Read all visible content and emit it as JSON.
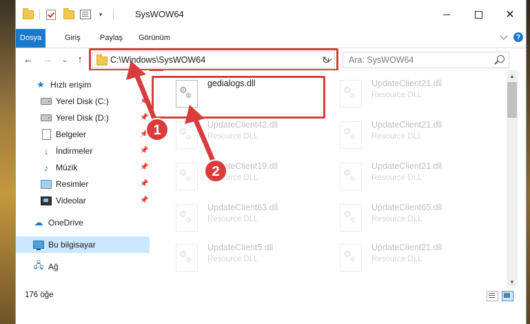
{
  "window": {
    "title": "SysWOW64"
  },
  "window_controls": {
    "minimize": "",
    "maximize": "",
    "close": "✕"
  },
  "ribbon": {
    "tabs": [
      "Dosya",
      "Giriş",
      "Paylaş",
      "Görünüm"
    ],
    "help": "?"
  },
  "navigation": {
    "back": "←",
    "forward": "→",
    "recent": "⌄",
    "up": "↑"
  },
  "address": {
    "path": "C:\\Windows\\SysWOW64",
    "refresh": "↻"
  },
  "search": {
    "placeholder": "Ara: SysWOW64"
  },
  "nav_pane": {
    "items": [
      {
        "label": "Hızlı erişim",
        "icon": "star-icon",
        "pinned": false
      },
      {
        "label": "Yerel Disk (C:)",
        "icon": "drive-icon",
        "pinned": true
      },
      {
        "label": "Yerel Disk (D:)",
        "icon": "drive-icon",
        "pinned": true
      },
      {
        "label": "Belgeler",
        "icon": "document-icon",
        "pinned": true
      },
      {
        "label": "İndirmeler",
        "icon": "download-icon",
        "pinned": true
      },
      {
        "label": "Müzik",
        "icon": "music-icon",
        "pinned": true
      },
      {
        "label": "Resimler",
        "icon": "pictures-icon",
        "pinned": true
      },
      {
        "label": "Videolar",
        "icon": "video-icon",
        "pinned": true
      },
      {
        "label": "OneDrive",
        "icon": "cloud-icon",
        "pinned": false
      },
      {
        "label": "Bu bilgisayar",
        "icon": "computer-icon",
        "pinned": false,
        "selected": true
      },
      {
        "label": "Ağ",
        "icon": "network-icon",
        "pinned": false
      }
    ]
  },
  "files": {
    "highlighted": {
      "name": "gedialogs.dll",
      "type": ""
    },
    "faded": [
      {
        "name": "UpdateClient21.dll",
        "type": "Resource DLL"
      },
      {
        "name": "UpdateClient42.dll",
        "type": "Resource DLL"
      },
      {
        "name": "UpdateClient21.dll",
        "type": "Resource DLL"
      },
      {
        "name": "UpdateClient19.dll",
        "type": "Resource DLL"
      },
      {
        "name": "UpdateClient21.dll",
        "type": "Resource DLL"
      },
      {
        "name": "UpdateClient63.dll",
        "type": "Resource DLL"
      },
      {
        "name": "UpdateClient65.dll",
        "type": "Resource DLL"
      },
      {
        "name": "UpdateClient5.dll",
        "type": "Resource DLL"
      },
      {
        "name": "UpdateClient21.dll",
        "type": "Resource DLL"
      }
    ]
  },
  "status": {
    "item_count": "176 öğe"
  },
  "annotations": {
    "step1": "1",
    "step2": "2",
    "highlight_color": "#d83c3c"
  }
}
